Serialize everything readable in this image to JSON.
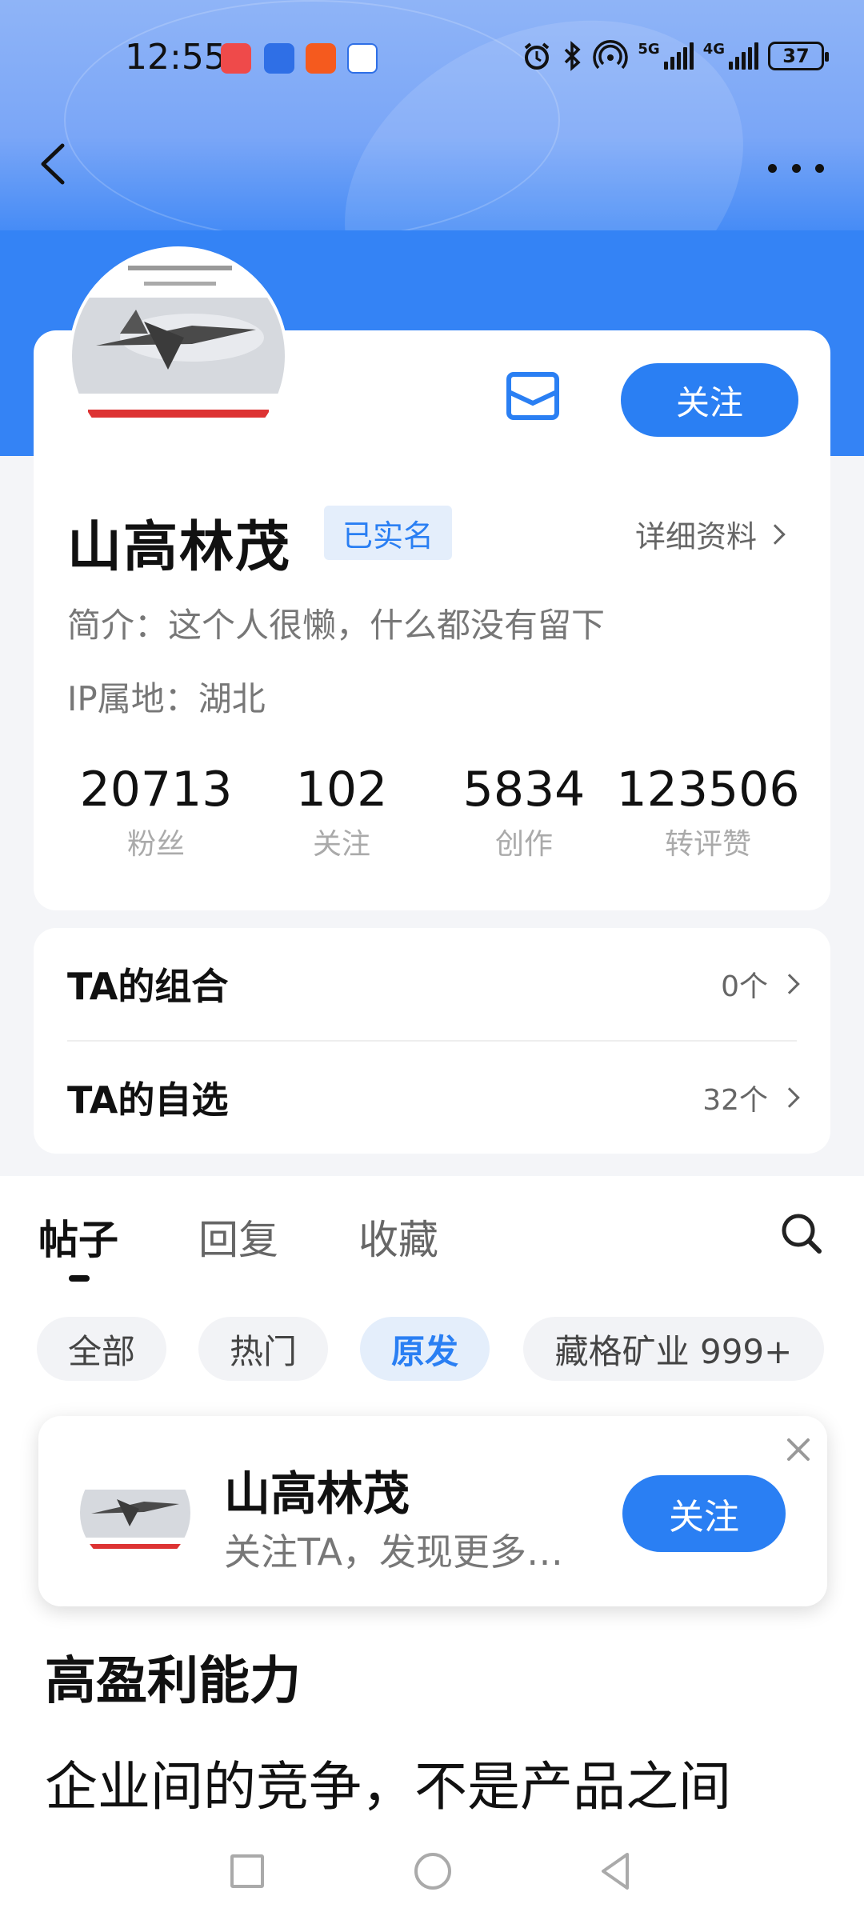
{
  "status_bar": {
    "time": "12:55",
    "app_icons": [
      "huawei-store-icon",
      "app-icon-blue",
      "app-icon-orange",
      "browser-icon"
    ],
    "signal_5g_label": "5G",
    "signal_4g_label": "4G",
    "battery": "37"
  },
  "header": {
    "back_icon": "chevron-left-icon",
    "more_icon": "more-dots-icon"
  },
  "profile": {
    "name": "山高林茂",
    "verified_label": "已实名",
    "detail_link": "详细资料",
    "bio": "简介：这个人很懒，什么都没有留下",
    "ip": "IP属地：湖北",
    "follow_label": "关注",
    "stats": [
      {
        "value": "20713",
        "label": "粉丝"
      },
      {
        "value": "102",
        "label": "关注"
      },
      {
        "value": "5834",
        "label": "创作"
      },
      {
        "value": "123506",
        "label": "转评赞"
      }
    ]
  },
  "lists": [
    {
      "title": "TA的组合",
      "value": "0个"
    },
    {
      "title": "TA的自选",
      "value": "32个"
    }
  ],
  "tabs": [
    {
      "label": "帖子",
      "active": true
    },
    {
      "label": "回复",
      "active": false
    },
    {
      "label": "收藏",
      "active": false
    }
  ],
  "chips": [
    {
      "label": "全部",
      "active": false
    },
    {
      "label": "热门",
      "active": false
    },
    {
      "label": "原发",
      "active": true
    },
    {
      "label": "藏格矿业 999+",
      "active": false
    }
  ],
  "popup": {
    "name": "山高林茂",
    "subtitle": "关注TA，发现更多…",
    "follow_label": "关注"
  },
  "post": {
    "title": "高盈利能力",
    "body": "企业间的竞争，不是产品之间"
  },
  "colors": {
    "accent": "#2a7ff3",
    "header_blue": "#3483f5"
  }
}
